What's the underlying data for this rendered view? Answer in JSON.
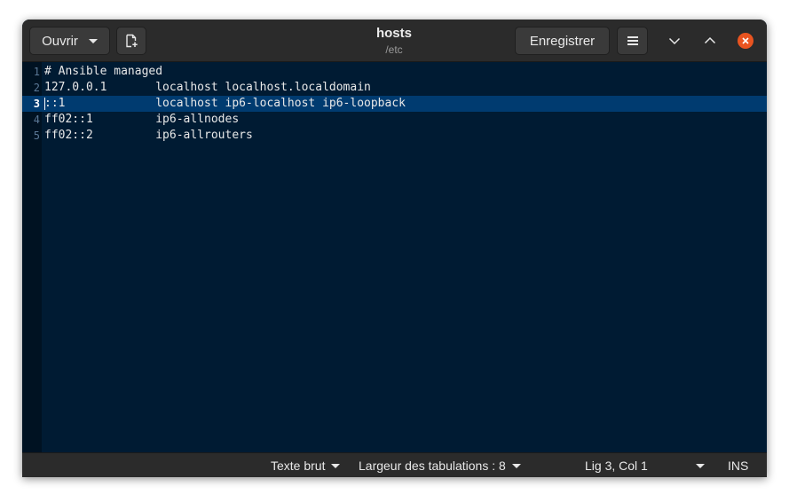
{
  "window": {
    "title": "hosts",
    "subtitle": "/etc"
  },
  "header": {
    "open_label": "Ouvrir",
    "save_label": "Enregistrer",
    "icons": {
      "open_menu": "chevron-down-icon",
      "new_document": "new-document-icon",
      "hamburger_menu": "hamburger-menu-icon",
      "minimize": "minimize-icon",
      "maximize": "maximize-icon",
      "close": "close-icon"
    },
    "colors": {
      "close_accent": "#e95420"
    }
  },
  "editor": {
    "current_line": 3,
    "lines": [
      {
        "number": "1",
        "text": "# Ansible managed"
      },
      {
        "number": "2",
        "text": "127.0.0.1       localhost localhost.localdomain"
      },
      {
        "number": "3",
        "text": "::1             localhost ip6-localhost ip6-loopback"
      },
      {
        "number": "4",
        "text": "ff02::1         ip6-allnodes"
      },
      {
        "number": "5",
        "text": "ff02::2         ip6-allrouters"
      }
    ],
    "colors": {
      "background": "#001b33",
      "current_line": "#003b70"
    }
  },
  "statusbar": {
    "language": "Texte brut",
    "tab_width": "Largeur des tabulations : 8",
    "position": "Lig 3, Col 1",
    "mode": "INS"
  }
}
